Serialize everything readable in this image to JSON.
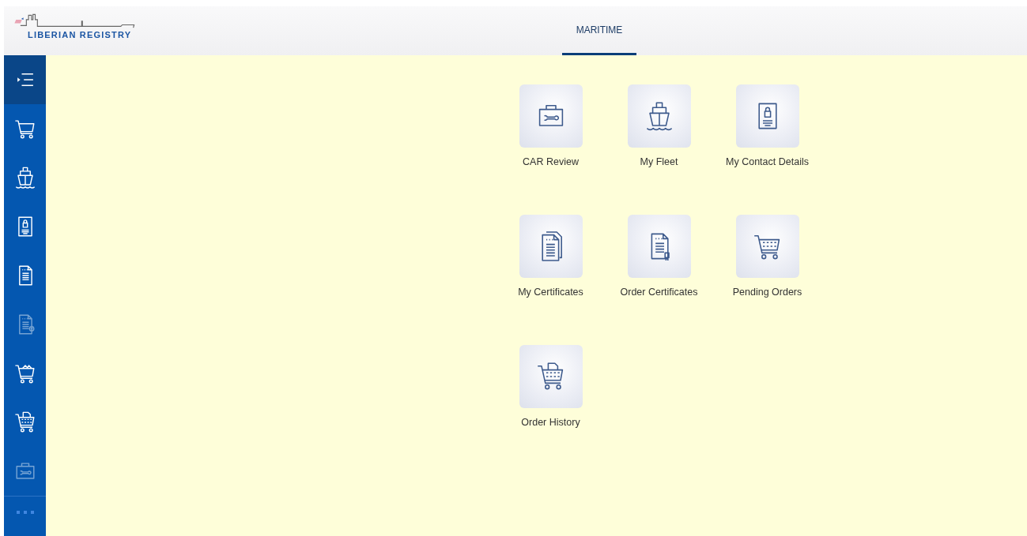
{
  "header": {
    "logo_text": "LIBERIAN REGISTRY",
    "tabs": [
      {
        "label": "MARITIME",
        "selected": true
      }
    ]
  },
  "sidebar": {
    "items": [
      {
        "kind": "menu",
        "selected": true,
        "disabled": false
      },
      {
        "kind": "cart",
        "selected": false,
        "disabled": false
      },
      {
        "kind": "ship",
        "selected": false,
        "disabled": false
      },
      {
        "kind": "contact",
        "selected": false,
        "disabled": false
      },
      {
        "kind": "document",
        "selected": false,
        "disabled": false
      },
      {
        "kind": "doc-plus",
        "selected": false,
        "disabled": true
      },
      {
        "kind": "cart-goods",
        "selected": false,
        "disabled": false
      },
      {
        "kind": "cart-doc",
        "selected": false,
        "disabled": false
      },
      {
        "kind": "toolbox",
        "selected": false,
        "disabled": true
      },
      {
        "kind": "more",
        "selected": false,
        "disabled": false
      }
    ]
  },
  "tiles": [
    {
      "label": "CAR Review",
      "kind": "toolbox"
    },
    {
      "label": "My Fleet",
      "kind": "ship"
    },
    {
      "label": "My Contact Details",
      "kind": "contact"
    },
    {
      "label": "My Certificates",
      "kind": "documents"
    },
    {
      "label": "Order Certificates",
      "kind": "cert-order"
    },
    {
      "label": "Pending Orders",
      "kind": "cart-grid"
    },
    {
      "label": "Order History",
      "kind": "cart-doc"
    }
  ]
}
